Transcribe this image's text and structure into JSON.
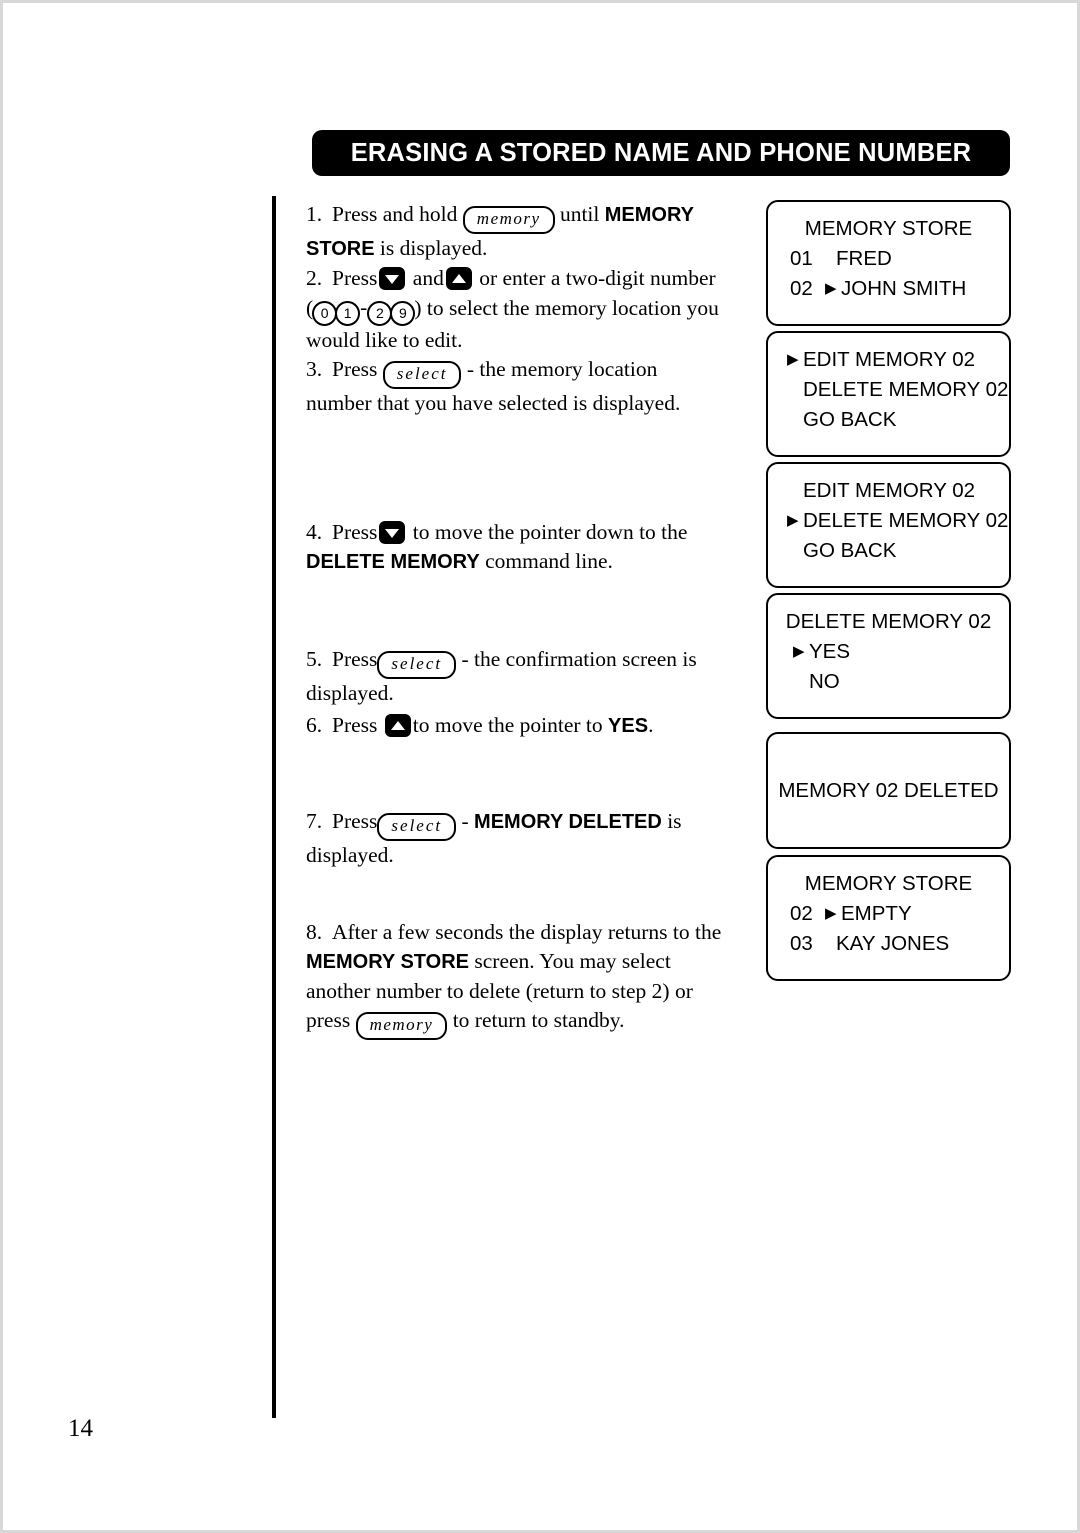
{
  "document": {
    "title": "ERASING A STORED NAME AND PHONE NUMBER",
    "page_number": "14"
  },
  "keys": {
    "memory": "memory",
    "select": "select"
  },
  "steps": [
    {
      "num": "1.",
      "segments": [
        {
          "t": "text",
          "v": "Press and hold "
        },
        {
          "t": "key",
          "v": "memory"
        },
        {
          "t": "text",
          "v": " until "
        },
        {
          "t": "bold",
          "v": "MEMORY STORE"
        },
        {
          "t": "text",
          "v": " is displayed."
        }
      ]
    },
    {
      "num": "2.",
      "segments": [
        {
          "t": "text",
          "v": "Press"
        },
        {
          "t": "btn-down",
          "v": "down-arrow"
        },
        {
          "t": "text",
          "v": " and"
        },
        {
          "t": "btn-up",
          "v": "up-arrow"
        },
        {
          "t": "text",
          "v": " or enter a two-digit number ("
        },
        {
          "t": "digits",
          "v": "01-29"
        },
        {
          "t": "text",
          "v": ") to select the memory location you would like to edit."
        }
      ]
    },
    {
      "num": "3.",
      "segments": [
        {
          "t": "text",
          "v": "Press "
        },
        {
          "t": "key",
          "v": "select"
        },
        {
          "t": "text",
          "v": " - the memory location number that you have selected is displayed."
        }
      ]
    },
    {
      "num": "4.",
      "segments": [
        {
          "t": "text",
          "v": "Press "
        },
        {
          "t": "btn-down",
          "v": "down-arrow"
        },
        {
          "t": "text",
          "v": " to move the pointer down to the "
        },
        {
          "t": "bold",
          "v": "DELETE MEMORY"
        },
        {
          "t": "text",
          "v": " command line."
        }
      ]
    },
    {
      "num": "5.",
      "segments": [
        {
          "t": "text",
          "v": "Press"
        },
        {
          "t": "key",
          "v": "select"
        },
        {
          "t": "text",
          "v": " - the confirmation screen is displayed."
        }
      ]
    },
    {
      "num": "6.",
      "segments": [
        {
          "t": "text",
          "v": "Press "
        },
        {
          "t": "btn-up",
          "v": "up-arrow"
        },
        {
          "t": "text",
          "v": " to move the pointer to "
        },
        {
          "t": "bold",
          "v": "YES"
        },
        {
          "t": "text",
          "v": "."
        }
      ]
    },
    {
      "num": "7.",
      "segments": [
        {
          "t": "text",
          "v": "Press"
        },
        {
          "t": "key",
          "v": "select"
        },
        {
          "t": "text",
          "v": " - "
        },
        {
          "t": "bold",
          "v": "MEMORY DELETED"
        },
        {
          "t": "text",
          "v": " is displayed."
        }
      ]
    },
    {
      "num": "8.",
      "segments": [
        {
          "t": "text",
          "v": "After a few seconds the display returns to the "
        },
        {
          "t": "bold",
          "v": "MEMORY STORE"
        },
        {
          "t": "text",
          "v": " screen. You may select another number to delete (return to step 2) or press "
        },
        {
          "t": "key",
          "v": "memory"
        },
        {
          "t": "text",
          "v": " to return to standby."
        }
      ]
    }
  ],
  "step_texts": {
    "s1_a": "Press and hold",
    "s1_b": "until",
    "s1_bold": "MEMORY",
    "s1_bold2": "STORE",
    "s1_c": "is displayed.",
    "s2_a": "Press",
    "s2_and": "and",
    "s2_b": "or enter a two-digit",
    "s2_c": "number (",
    "s2_d": ") to select the",
    "s2_e": "memory location you would like to edit.",
    "s3_a": "Press",
    "s3_b": "- the memory location",
    "s3_c": "number that you have selected is displayed.",
    "s4_a": "Press",
    "s4_b": "to move the pointer down to the",
    "s4_bold": "DELETE MEMORY",
    "s4_c": "command line.",
    "s5_a": "Press",
    "s5_b": "- the confirmation",
    "s5_c": "screen is displayed.",
    "s6_a": "Press",
    "s6_b": "to move the pointer to",
    "s6_bold": "YES",
    "s6_dot": ".",
    "s7_a": "Press",
    "s7_dash": "-",
    "s7_bold": "MEMORY DELETED",
    "s7_b": "is",
    "s7_c": "displayed.",
    "s8_a": "After a few seconds the display returns to the",
    "s8_bold": "MEMORY STORE",
    "s8_b": "screen. You may select",
    "s8_c": "another number to delete (return to step 2)",
    "s8_d": "or press",
    "s8_e": "to return to standby."
  },
  "digits": {
    "d0": "0",
    "d1": "1",
    "d2": "2",
    "d9": "9",
    "dash": "-"
  },
  "numbering": {
    "n1": "1.",
    "n2": "2.",
    "n3": "3.",
    "n4": "4.",
    "n5": "5.",
    "n6": "6.",
    "n7": "7.",
    "n8": "8."
  },
  "screens": [
    {
      "name": "memory-store-initial",
      "lines": [
        {
          "idx": "",
          "ptr": "",
          "txt": "MEMORY STORE",
          "center": true
        },
        {
          "idx": "01",
          "ptr": "",
          "txt": "FRED"
        },
        {
          "idx": "02",
          "ptr": "▶",
          "txt": "JOHN SMITH"
        }
      ]
    },
    {
      "name": "edit-memory-selected",
      "lines": [
        {
          "idx": "",
          "ptr": "▶",
          "txt": "EDIT MEMORY 02"
        },
        {
          "idx": "",
          "ptr": "",
          "txt": "DELETE MEMORY 02"
        },
        {
          "idx": "",
          "ptr": "",
          "txt": "GO BACK"
        }
      ]
    },
    {
      "name": "delete-memory-selected",
      "lines": [
        {
          "idx": "",
          "ptr": "",
          "txt": "EDIT MEMORY 02"
        },
        {
          "idx": "",
          "ptr": "▶",
          "txt": "DELETE MEMORY 02"
        },
        {
          "idx": "",
          "ptr": "",
          "txt": "GO BACK"
        }
      ]
    },
    {
      "name": "delete-confirmation",
      "lines": [
        {
          "idx": "",
          "ptr": "",
          "txt": "DELETE MEMORY 02",
          "center": true
        },
        {
          "idx": "",
          "ptr": "▶",
          "txt": "YES"
        },
        {
          "idx": "",
          "ptr": "",
          "txt": "NO"
        }
      ]
    },
    {
      "name": "memory-deleted",
      "lines": [
        {
          "idx": "",
          "ptr": "",
          "txt": "MEMORY 02 DELETED",
          "center": true
        }
      ]
    },
    {
      "name": "memory-store-after",
      "lines": [
        {
          "idx": "",
          "ptr": "",
          "txt": "MEMORY STORE",
          "center": true
        },
        {
          "idx": "02",
          "ptr": "▶",
          "txt": "EMPTY"
        },
        {
          "idx": "03",
          "ptr": "",
          "txt": "KAY JONES"
        }
      ]
    }
  ],
  "screen_text": {
    "s1_l1": "MEMORY STORE",
    "s1_l2_idx": "01",
    "s1_l2_txt": "FRED",
    "s1_l3_idx": "02",
    "s1_l3_txt": "JOHN SMITH",
    "s2_l1": "EDIT MEMORY 02",
    "s2_l2": "DELETE MEMORY 02",
    "s2_l3": "GO BACK",
    "s3_l1": "EDIT MEMORY 02",
    "s3_l2": "DELETE MEMORY 02",
    "s3_l3": "GO BACK",
    "s4_l1": "DELETE MEMORY 02",
    "s4_l2": "YES",
    "s4_l3": "NO",
    "s5_l1": "MEMORY 02 DELETED",
    "s6_l1": "MEMORY STORE",
    "s6_l2_idx": "02",
    "s6_l2_txt": "EMPTY",
    "s6_l3_idx": "03",
    "s6_l3_txt": "KAY JONES"
  }
}
